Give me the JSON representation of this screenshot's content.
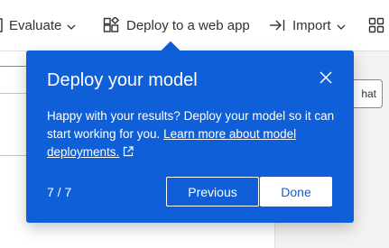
{
  "toolbar": {
    "evaluate_label": "Evaluate",
    "deploy_label": "Deploy to a web app",
    "import_label": "Import"
  },
  "background": {
    "chat_button_partial": "hat"
  },
  "teaching_bubble": {
    "title": "Deploy your model",
    "body_text": "Happy with your results? Deploy your model so it can start working for you.",
    "link_text": "Learn more about model deployments.",
    "step_counter": "7 / 7",
    "previous_label": "Previous",
    "done_label": "Done"
  },
  "colors": {
    "bubble_background": "#0f5fd8",
    "bubble_text": "#ffffff",
    "toolbar_text": "#323130"
  },
  "icons": [
    "evaluate-icon",
    "deploy-app-icon",
    "import-icon",
    "apps-grid-icon",
    "chevron-down-icon",
    "close-icon",
    "external-link-icon"
  ]
}
